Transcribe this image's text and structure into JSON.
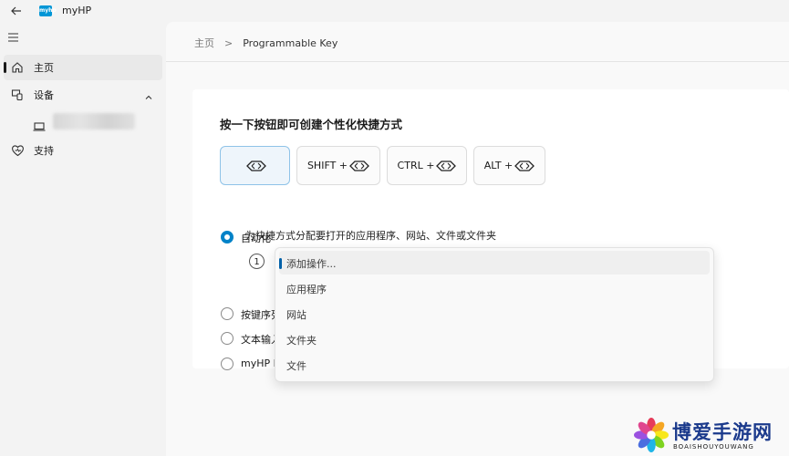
{
  "window": {
    "title": "myHP",
    "logo_text": "myhp"
  },
  "sidebar": {
    "items": [
      {
        "label": "主页",
        "icon": "home-icon",
        "active": true
      },
      {
        "label": "设备",
        "icon": "devices-icon",
        "active": false
      },
      {
        "label": "支持",
        "icon": "support-heart-icon",
        "active": false
      }
    ]
  },
  "breadcrumb": {
    "home": "主页",
    "separator": ">",
    "current": "Programmable Key"
  },
  "card": {
    "title": "按一下按钮即可创建个性化快捷方式",
    "keys": [
      {
        "label": "",
        "selected": true
      },
      {
        "label": "SHIFT +",
        "selected": false
      },
      {
        "label": "CTRL +",
        "selected": false
      },
      {
        "label": "ALT +",
        "selected": false
      }
    ],
    "options": [
      {
        "label": "自动化",
        "checked": true
      },
      {
        "label": "按键序列",
        "checked": false
      },
      {
        "label": "文本输入",
        "checked": false
      },
      {
        "label": "myHP P",
        "checked": false
      }
    ],
    "automation_description": "为快捷方式分配要打开的应用程序、网站、文件或文件夹",
    "step_number": "1"
  },
  "dropdown": {
    "items": [
      {
        "label": "添加操作...",
        "highlight": true
      },
      {
        "label": "应用程序",
        "highlight": false
      },
      {
        "label": "网站",
        "highlight": false
      },
      {
        "label": "文件夹",
        "highlight": false
      },
      {
        "label": "文件",
        "highlight": false
      }
    ]
  },
  "watermark": {
    "title": "博爱手游网",
    "subtitle": "BOAISHOUYOUWANG"
  },
  "colors": {
    "accent": "#0082c8",
    "brand": "#0096d6",
    "watermark": "#1b3a8c"
  }
}
